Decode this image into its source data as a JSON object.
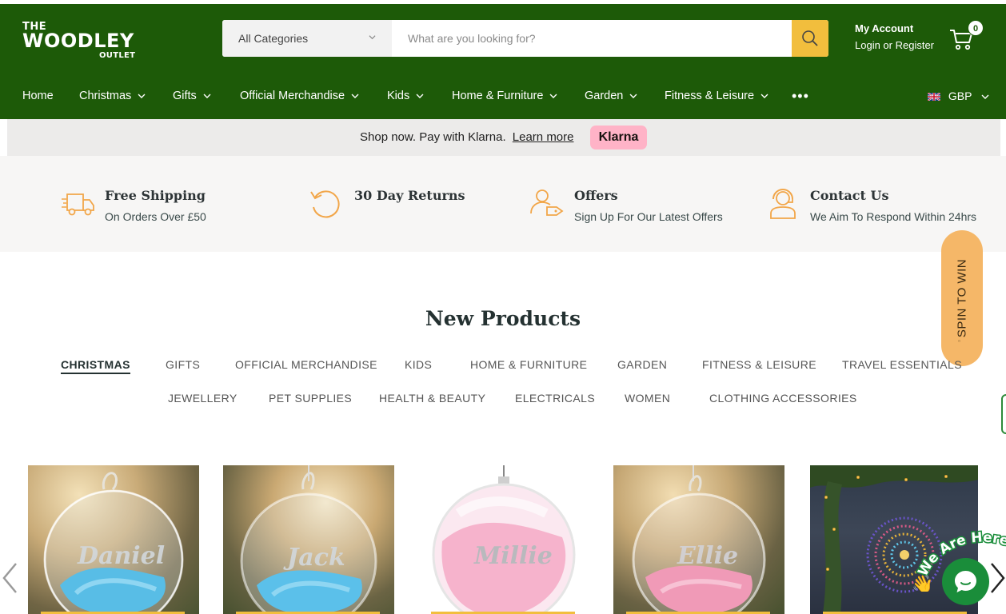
{
  "brand": {
    "line1": "THE",
    "line2": "WOODLEY",
    "line3": "OUTLET",
    "colors": {
      "primary": "#1d5a08",
      "accent": "#f2be3d",
      "icon": "#f2a649"
    }
  },
  "search": {
    "category": "All Categories",
    "placeholder": "What are you looking for?",
    "button_icon": "search-icon"
  },
  "account": {
    "title": "My Account",
    "links": "Login or Register"
  },
  "cart": {
    "count": "0",
    "icon": "cart-icon"
  },
  "nav": {
    "items": [
      {
        "label": "Home"
      },
      {
        "label": "Christmas"
      },
      {
        "label": "Gifts"
      },
      {
        "label": "Official Merchandise"
      },
      {
        "label": "Kids"
      },
      {
        "label": "Home & Furniture"
      },
      {
        "label": "Garden"
      },
      {
        "label": "Fitness & Leisure"
      }
    ],
    "more": "•••",
    "currency": "GBP"
  },
  "klarna": {
    "text": "Shop now. Pay with Klarna.",
    "link": "Learn more",
    "badge": "Klarna"
  },
  "features": [
    {
      "title": "Free Shipping",
      "subtitle": "On Orders Over £50",
      "icon": "delivery-truck-icon"
    },
    {
      "title": "30 Day Returns",
      "subtitle": "",
      "icon": "return-arrow-icon"
    },
    {
      "title": "Offers",
      "subtitle": "Sign Up For Our Latest Offers",
      "icon": "user-tag-icon"
    },
    {
      "title": "Contact Us",
      "subtitle": "We Aim To Respond Within 24hrs",
      "icon": "headset-icon"
    }
  ],
  "spin": {
    "label": "SPIN TO WIN"
  },
  "new_products": {
    "title": "New Products",
    "tabs": [
      "CHRISTMAS",
      "GIFTS",
      "OFFICIAL MERCHANDISE",
      "KIDS",
      "HOME & FURNITURE",
      "GARDEN",
      "FITNESS & LEISURE",
      "TRAVEL ESSENTIALS",
      "JEWELLERY",
      "PET SUPPLIES",
      "HEALTH & BEAUTY",
      "ELECTRICALS",
      "WOMEN",
      "CLOTHING ACCESSORIES"
    ],
    "active_tab": "CHRISTMAS",
    "products": [
      {
        "name_on_bauble": "Daniel",
        "feather": "#58bde6"
      },
      {
        "name_on_bauble": "Jack",
        "feather": "#5bc0ea"
      },
      {
        "name_on_bauble": "Millie",
        "feather": "#f4a9c6"
      },
      {
        "name_on_bauble": "Ellie",
        "feather": "#f09ab7"
      },
      {
        "name_on_bauble": "",
        "feather": ""
      }
    ]
  },
  "chat": {
    "banner": "We Are Here!"
  }
}
